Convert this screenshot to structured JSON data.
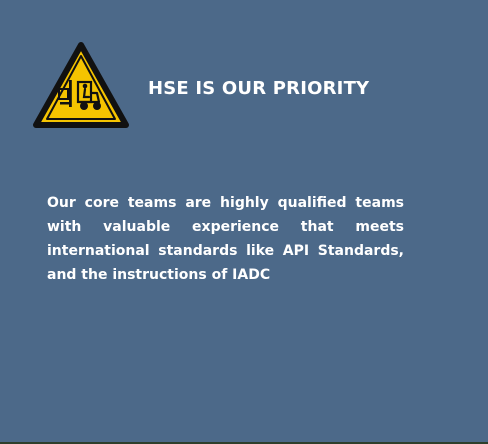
{
  "section": {
    "title": "HSE IS OUR PRIORITY",
    "description": "Our core teams are highly qualified teams with valuable experience that meets international standards like API Standards, and the instructions of IADC",
    "icon": "forklift-warning-icon"
  },
  "colors": {
    "panel_background": "#4c6989",
    "text": "#ffffff",
    "warning_yellow": "#f5c400",
    "warning_border": "#111111"
  }
}
